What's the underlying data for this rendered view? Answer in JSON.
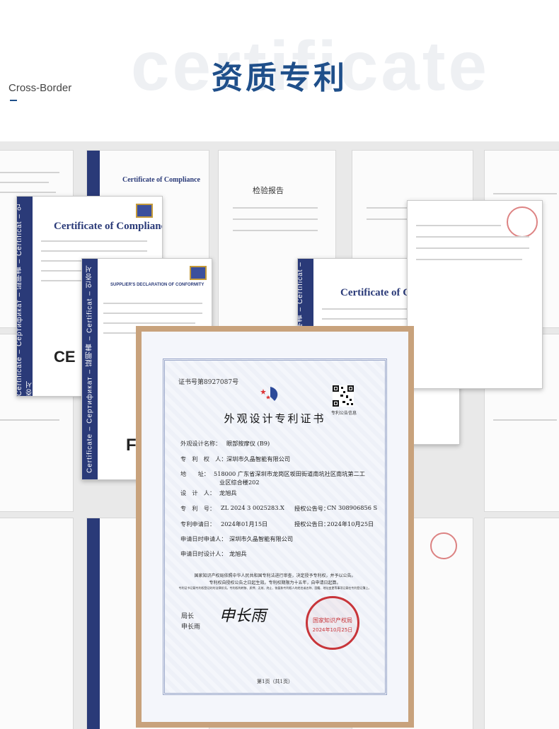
{
  "header": {
    "watermark": "certificate",
    "title": "资质专利",
    "cross_border": "Cross-Border"
  },
  "documents": {
    "coc_title": "Certificate of Compliance",
    "supplier_decl": "SUPPLIER'S DECLARATION OF CONFORMITY",
    "inspection_report": "检验报告",
    "ce_mark": "CE",
    "fc_mark": "FC",
    "side_text": "Certificate – Сертификат – 証明書 – Certificat – 인증서"
  },
  "patent": {
    "cert_no": "证书号第8927087号",
    "qr_label": "专利公告信息",
    "title": "外观设计专利证书",
    "rows": [
      {
        "label": "外观设计名称：",
        "value": "眼部按摩仪 (B9)"
      },
      {
        "label": "专　利　权　人：",
        "value": "深圳市久晶智能有限公司"
      },
      {
        "label": "地　　址：",
        "value": "518000 广东省深圳市龙岗区坂田街道南坑社区南坑第二工"
      },
      {
        "label": "",
        "value": "业区综合楼202"
      },
      {
        "label": "设　计　人：",
        "value": "龙旭兵"
      },
      {
        "label": "专　利　号：",
        "value": "ZL 2024 3 0025283.X"
      },
      {
        "label": "专利申请日：",
        "value": "2024年01月15日"
      },
      {
        "label": "申请日时申请人：",
        "value": "深圳市久晶智能有限公司"
      },
      {
        "label": "申请日时设计人：",
        "value": "龙旭兵"
      }
    ],
    "grant_no_label": "授权公告号：",
    "grant_no": "CN 308906856 S",
    "grant_date_label": "授权公告日：",
    "grant_date": "2024年10月25日",
    "notice_1": "国家知识产权局依照中华人民共和国专利法进行审查，决定授予专利权，并予以公告。",
    "notice_2": "专利权自授权公告之日起生效。专利权期限为十五年，自申请日起算。",
    "notice_3": "专利证书记载专利权登记时的法律状况。专利权的转移、质押、无效、终止、恢复和专利权人的姓名或名称、国籍、地址变更等事项记载在专利登记簿上。",
    "director_label": "局长",
    "director_name": "申长雨",
    "signature": "申长雨",
    "seal_text": "国家知识产权局",
    "seal_date": "2024年10月25日",
    "page_footer": "第1页（共1页）"
  }
}
